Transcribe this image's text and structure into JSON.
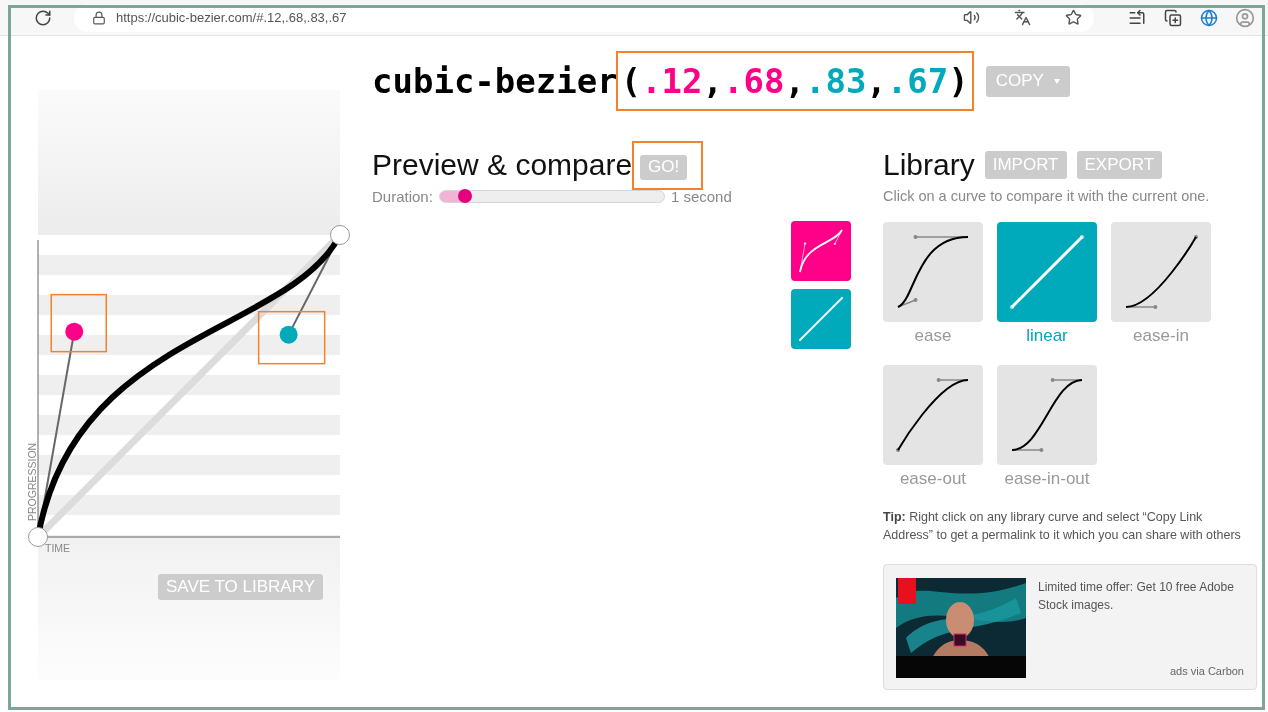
{
  "browser": {
    "url": "https://cubic-bezier.com/#.12,.68,.83,.67"
  },
  "editor": {
    "y_axis_label": "PROGRESSION",
    "x_axis_label": "TIME",
    "handles": [
      {
        "color": "#ff0088",
        "highlighted": true
      },
      {
        "color": "#00aabb",
        "highlighted": true
      }
    ],
    "save_button": "SAVE TO LIBRARY"
  },
  "title": {
    "function": "cubic-bezier",
    "open": "(",
    "args": [
      {
        "text": ".12",
        "separator": ",",
        "color": "#ff0088"
      },
      {
        "text": ".68",
        "separator": ",",
        "color": "#ff0088"
      },
      {
        "text": ".83",
        "separator": ",",
        "color": "#00aabb"
      },
      {
        "text": ".67",
        "color": "#00aabb"
      }
    ],
    "close": ")",
    "highlighted": true,
    "copy_button": "COPY"
  },
  "preview": {
    "heading": "Preview & compare",
    "go_button": "GO!",
    "go_highlighted": true,
    "duration_label": "Duration:",
    "duration": {
      "level": 0.11
    },
    "duration_value": "1 second",
    "compare_tiles": [
      {
        "kind": "current",
        "color": "#ff0088"
      },
      {
        "kind": "compare",
        "color": "#00aabb"
      }
    ]
  },
  "library": {
    "heading": "Library",
    "buttons": [
      "IMPORT",
      "EXPORT"
    ],
    "hint": "Click on a curve to compare it with the current one.",
    "curves": [
      {
        "name": "ease",
        "selected": false
      },
      {
        "name": "linear",
        "selected": true
      },
      {
        "name": "ease-in",
        "selected": false
      },
      {
        "name": "ease-out",
        "selected": false
      },
      {
        "name": "ease-in-out",
        "selected": false
      }
    ],
    "tip": "**Tip:** Right click on any library curve and select “Copy Link Address” to get a permalink to it which you can share with others"
  },
  "ad": {
    "text": "Limited time offer: Get 10 free Adobe Stock images.",
    "credit": "ads via Carbon"
  }
}
